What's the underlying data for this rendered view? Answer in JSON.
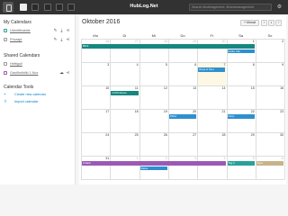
{
  "header": {
    "brand": "HubLog.Net",
    "search_text": "Search #hubhagement, #hubzmanagement"
  },
  "sidebar": {
    "my_calendars_title": "My Calendars",
    "my_calendars": [
      {
        "name": "Ubertiftnabbir",
        "color": "#2aa198"
      },
      {
        "name": "Privasje",
        "color": "#cccccc"
      }
    ],
    "shared_calendars_title": "Shared Calendars",
    "shared_calendars": [
      {
        "name": "Heftigull",
        "color": "#cccccc"
      },
      {
        "name": "Gasifhniktiki 1.Noz",
        "color": "#9b59b6"
      }
    ],
    "tools_title": "Calendar Tools",
    "tools": [
      {
        "label": "Create new calendar",
        "icon": "plus-icon"
      },
      {
        "label": "Import calendar",
        "icon": "upload-icon"
      }
    ]
  },
  "calendar": {
    "month_title": "Oktober 2016",
    "view_button": "Monat",
    "days": [
      "Mo",
      "Di",
      "Mi",
      "Do",
      "Fr",
      "Sa",
      "So"
    ],
    "weeks": [
      [
        "26",
        "27",
        "28",
        "29",
        "30",
        "1",
        "2"
      ],
      [
        "3",
        "4",
        "5",
        "6",
        "7",
        "8",
        "9"
      ],
      [
        "10",
        "11",
        "12",
        "13",
        "14",
        "15",
        "16"
      ],
      [
        "17",
        "18",
        "19",
        "20",
        "21",
        "22",
        "23"
      ],
      [
        "24",
        "25",
        "26",
        "27",
        "28",
        "29",
        "30"
      ],
      [
        "31",
        "1",
        "2",
        "3",
        "4",
        "5",
        "6"
      ]
    ],
    "events": [
      {
        "label": "Blick",
        "color": "#16877f"
      },
      {
        "label": "Keller Info",
        "color": "#2f8fcf"
      },
      {
        "label": "Rugs & Kino",
        "color": "#2f8fcf"
      },
      {
        "label": "14:00 Essen",
        "color": "#16877f"
      },
      {
        "label": "Pkbw",
        "color": "#2f8fcf"
      },
      {
        "label": "Party",
        "color": "#2f8fcf"
      },
      {
        "label": "Urlaub",
        "color": "#9b59b6"
      },
      {
        "label": "Tag 2",
        "color": "#2aa198"
      },
      {
        "label": "Fest",
        "color": "#c8b48a"
      },
      {
        "label": "Reise",
        "color": "#2f8fcf"
      }
    ]
  }
}
